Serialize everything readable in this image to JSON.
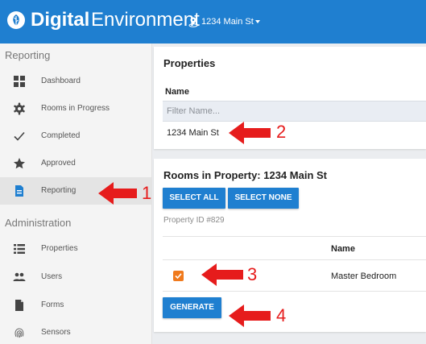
{
  "app": {
    "brand_bold": "Digital",
    "brand_light": "Environment",
    "location": "1234 Main St",
    "colors": {
      "primary": "#1f7fd0",
      "accent_orange": "#f07a1d",
      "annotation_red": "#e61c1c"
    }
  },
  "sidebar": {
    "reporting_header": "Reporting",
    "reporting_items": [
      {
        "label": "Dashboard",
        "icon": "dashboard-icon"
      },
      {
        "label": "Rooms in Progress",
        "icon": "gear-icon"
      },
      {
        "label": "Completed",
        "icon": "check-icon"
      },
      {
        "label": "Approved",
        "icon": "star-icon"
      },
      {
        "label": "Reporting",
        "icon": "document-icon",
        "active": true
      }
    ],
    "admin_header": "Administration",
    "admin_items": [
      {
        "label": "Properties",
        "icon": "list-icon"
      },
      {
        "label": "Users",
        "icon": "users-icon"
      },
      {
        "label": "Forms",
        "icon": "file-icon"
      },
      {
        "label": "Sensors",
        "icon": "fingerprint-icon"
      }
    ]
  },
  "properties_card": {
    "title": "Properties",
    "column_name": "Name",
    "filter_placeholder": "Filter Name...",
    "rows": [
      "1234 Main St"
    ]
  },
  "rooms_card": {
    "title": "Rooms in Property: 1234 Main St",
    "select_all": "SELECT ALL",
    "select_none": "SELECT NONE",
    "property_id": "Property ID #829",
    "column_name": "Name",
    "rows": [
      {
        "name": "Master Bedroom",
        "checked": true
      }
    ],
    "generate": "GENERATE"
  },
  "annotations": [
    "1",
    "2",
    "3",
    "4"
  ]
}
